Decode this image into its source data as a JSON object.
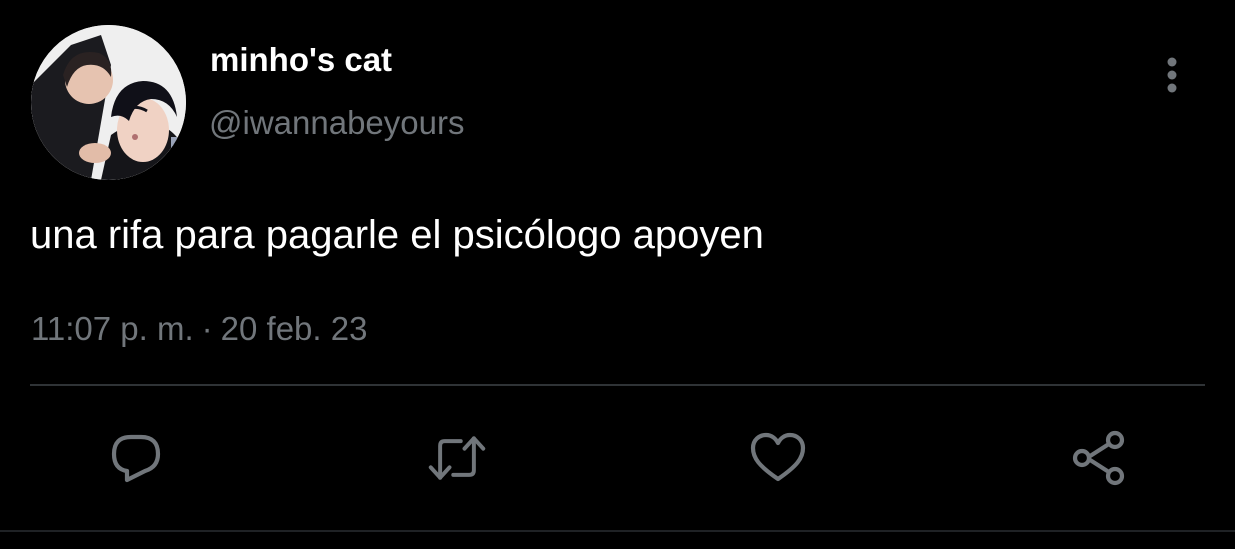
{
  "user": {
    "display_name": "minho's cat",
    "handle": "@iwannabeyours",
    "avatar_icon": "profile-photo"
  },
  "tweet": {
    "text": "una rifa para pagarle el psicólogo apoyen",
    "time": "11:07 p. m.",
    "separator": "·",
    "date": "20 feb. 23"
  },
  "actions": [
    {
      "name": "reply",
      "icon": "reply-icon"
    },
    {
      "name": "retweet",
      "icon": "retweet-icon"
    },
    {
      "name": "like",
      "icon": "heart-icon"
    },
    {
      "name": "share",
      "icon": "share-icon"
    }
  ],
  "colors": {
    "background": "#000000",
    "primary_text": "#ffffff",
    "secondary_text": "#71767b",
    "divider": "#2f3336",
    "icon": "#71767b"
  }
}
